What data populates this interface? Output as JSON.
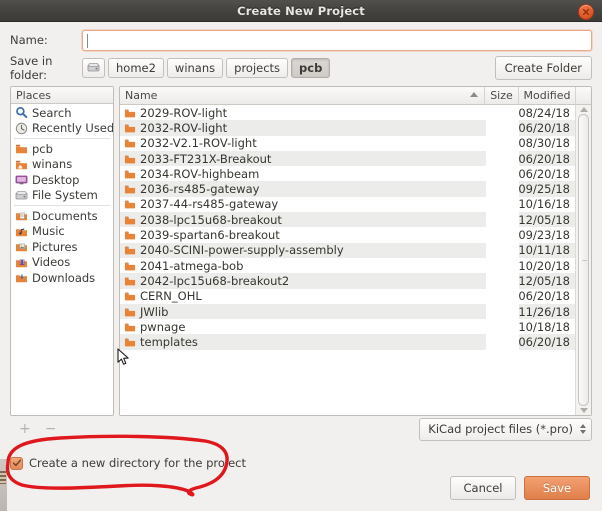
{
  "window": {
    "title": "Create New Project",
    "close_icon": "close-icon"
  },
  "form": {
    "name_label": "Name:",
    "name_value": "",
    "name_placeholder": "",
    "folder_label": "Save in folder:",
    "create_folder_label": "Create Folder"
  },
  "pathbar": {
    "drive_icon": "drive-icon",
    "items": [
      {
        "label": "home2",
        "active": false
      },
      {
        "label": "winans",
        "active": false
      },
      {
        "label": "projects",
        "active": false
      },
      {
        "label": "pcb",
        "active": true
      }
    ]
  },
  "places": {
    "header": "Places",
    "groups": [
      [
        {
          "label": "Search",
          "icon": "search-icon"
        },
        {
          "label": "Recently Used",
          "icon": "clock-icon"
        }
      ],
      [
        {
          "label": "pcb",
          "icon": "folder-icon"
        },
        {
          "label": "winans",
          "icon": "home-folder-icon"
        },
        {
          "label": "Desktop",
          "icon": "desktop-icon"
        },
        {
          "label": "File System",
          "icon": "drive-icon"
        }
      ],
      [
        {
          "label": "Documents",
          "icon": "documents-icon"
        },
        {
          "label": "Music",
          "icon": "music-icon"
        },
        {
          "label": "Pictures",
          "icon": "pictures-icon"
        },
        {
          "label": "Videos",
          "icon": "videos-icon"
        },
        {
          "label": "Downloads",
          "icon": "downloads-icon"
        }
      ]
    ],
    "add_label": "+",
    "remove_label": "−"
  },
  "filelist": {
    "columns": [
      "Name",
      "Size",
      "Modified"
    ],
    "sort_column": "Name",
    "sort_direction": "ascending",
    "rows": [
      {
        "name": "2029-ROV-light",
        "size": "",
        "modified": "08/24/18"
      },
      {
        "name": "2032-ROV-light",
        "size": "",
        "modified": "06/20/18"
      },
      {
        "name": "2032-V2.1-ROV-light",
        "size": "",
        "modified": "08/30/18"
      },
      {
        "name": "2033-FT231X-Breakout",
        "size": "",
        "modified": "06/20/18"
      },
      {
        "name": "2034-ROV-highbeam",
        "size": "",
        "modified": "06/20/18"
      },
      {
        "name": "2036-rs485-gateway",
        "size": "",
        "modified": "09/25/18"
      },
      {
        "name": "2037-44-rs485-gateway",
        "size": "",
        "modified": "10/16/18"
      },
      {
        "name": "2038-lpc15u68-breakout",
        "size": "",
        "modified": "12/05/18"
      },
      {
        "name": "2039-spartan6-breakout",
        "size": "",
        "modified": "09/23/18"
      },
      {
        "name": "2040-SCINI-power-supply-assembly",
        "size": "",
        "modified": "10/11/18"
      },
      {
        "name": "2041-atmega-bob",
        "size": "",
        "modified": "10/20/18"
      },
      {
        "name": "2042-lpc15u68-breakout2",
        "size": "",
        "modified": "12/05/18"
      },
      {
        "name": "CERN_OHL",
        "size": "",
        "modified": "06/20/18"
      },
      {
        "name": "JWlib",
        "size": "",
        "modified": "11/26/18"
      },
      {
        "name": "pwnage",
        "size": "",
        "modified": "10/18/18"
      },
      {
        "name": "templates",
        "size": "",
        "modified": "06/20/18"
      }
    ]
  },
  "filter": {
    "selected": "KiCad project files (*.pro)"
  },
  "options": {
    "create_dir_label": "Create a new directory for the project",
    "create_dir_checked": true
  },
  "actions": {
    "cancel_label": "Cancel",
    "save_label": "Save"
  },
  "annotation": {
    "color": "#e0171c",
    "shape": "hand-drawn-ellipse"
  }
}
